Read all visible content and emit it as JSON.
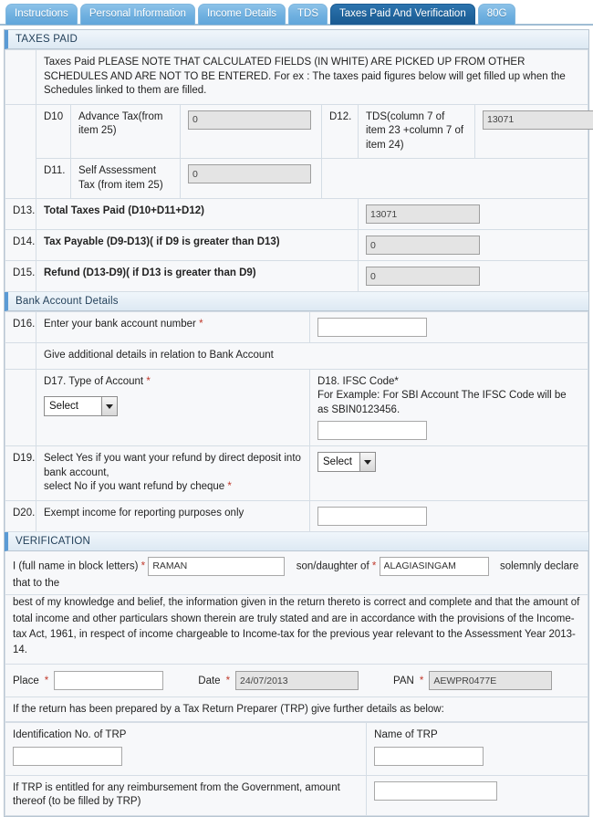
{
  "tabs": [
    {
      "label": "Instructions",
      "active": false
    },
    {
      "label": "Personal Information",
      "active": false
    },
    {
      "label": "Income Details",
      "active": false
    },
    {
      "label": "TDS",
      "active": false
    },
    {
      "label": "Taxes Paid And Verification",
      "active": true
    },
    {
      "label": "80G",
      "active": false
    }
  ],
  "taxes_paid": {
    "section_title": "TAXES PAID",
    "note": "Taxes Paid PLEASE NOTE THAT CALCULATED FIELDS (IN WHITE) ARE PICKED UP FROM OTHER SCHEDULES AND ARE NOT TO BE ENTERED. For ex : The taxes paid figures below will get filled up when the Schedules linked to them are filled.",
    "rows": [
      {
        "code": "D10",
        "label": "Advance Tax(from item 25)",
        "value": "0",
        "readonly": true
      },
      {
        "code": "D12.",
        "label": "TDS(column 7 of item 23 +column 7 of item 24)",
        "value": "13071",
        "readonly": true
      },
      {
        "code": "D11.",
        "label": "Self Assessment Tax (from item 25)",
        "value": "0",
        "readonly": true
      },
      {
        "code": "D13.",
        "label": "Total Taxes Paid (D10+D11+D12)",
        "value": "13071",
        "readonly": true
      },
      {
        "code": "D14.",
        "label": "Tax Payable (D9-D13)( if D9 is greater than D13)",
        "value": "0",
        "readonly": true
      },
      {
        "code": "D15.",
        "label": "Refund (D13-D9)( if D13 is greater than D9)",
        "value": "0",
        "readonly": true
      }
    ]
  },
  "bank": {
    "section_title": "Bank Account Details",
    "d16": {
      "code": "D16.",
      "label": "Enter your bank account number",
      "required": "*",
      "value": ""
    },
    "additional_details": "Give additional details in relation to Bank Account",
    "d17": {
      "code": "D17.",
      "label": "Type of Account",
      "required": "*",
      "selected": "Select"
    },
    "d18": {
      "code": "D18.",
      "label": "IFSC Code*",
      "hint": "For Example: For SBI Account The IFSC Code will be as SBIN0123456.",
      "value": ""
    },
    "d19": {
      "code": "D19.",
      "label_line1": "Select Yes if you want your refund by direct deposit into bank account,",
      "label_line2": "select No if you want refund by cheque",
      "required": "*",
      "selected": "Select"
    },
    "d20": {
      "code": "D20.",
      "label": "Exempt income for reporting purposes only",
      "value": ""
    }
  },
  "verification": {
    "section_title": "VERIFICATION",
    "intro_label": "I (full name in block letters)",
    "required": "*",
    "full_name": "RAMAN",
    "relation_label": "son/daughter of",
    "father_name": "ALAGIASINGAM",
    "after_name": "solemnly declare that to the",
    "declaration": "best of my knowledge and belief, the information given in the return thereto is correct and complete and that the amount of total income and other particulars shown therein are truly stated and are in accordance with the provisions of the Income- tax Act, 1961, in respect of income chargeable to Income-tax for the previous year relevant to the Assessment Year 2013-14.",
    "place_label": "Place",
    "place_value": "",
    "date_label": "Date",
    "date_value": "24/07/2013",
    "pan_label": "PAN",
    "pan_value": "AEWPR0477E"
  },
  "trp": {
    "intro": "If the return has been prepared by a Tax Return Preparer (TRP) give further details as below:",
    "id_label": "Identification No. of TRP",
    "id_value": "",
    "name_label": "Name of TRP",
    "name_value": "",
    "reimbursement_label": "If TRP is entitled for any reimbursement from the Government, amount thereof (to be filled by TRP)",
    "reimbursement_value": ""
  },
  "colors": {
    "tab_active": "#1f639c",
    "tab_inactive": "#6fb0e0",
    "section_header_border": "#5b9bd5",
    "required_star": "#c0392b"
  }
}
